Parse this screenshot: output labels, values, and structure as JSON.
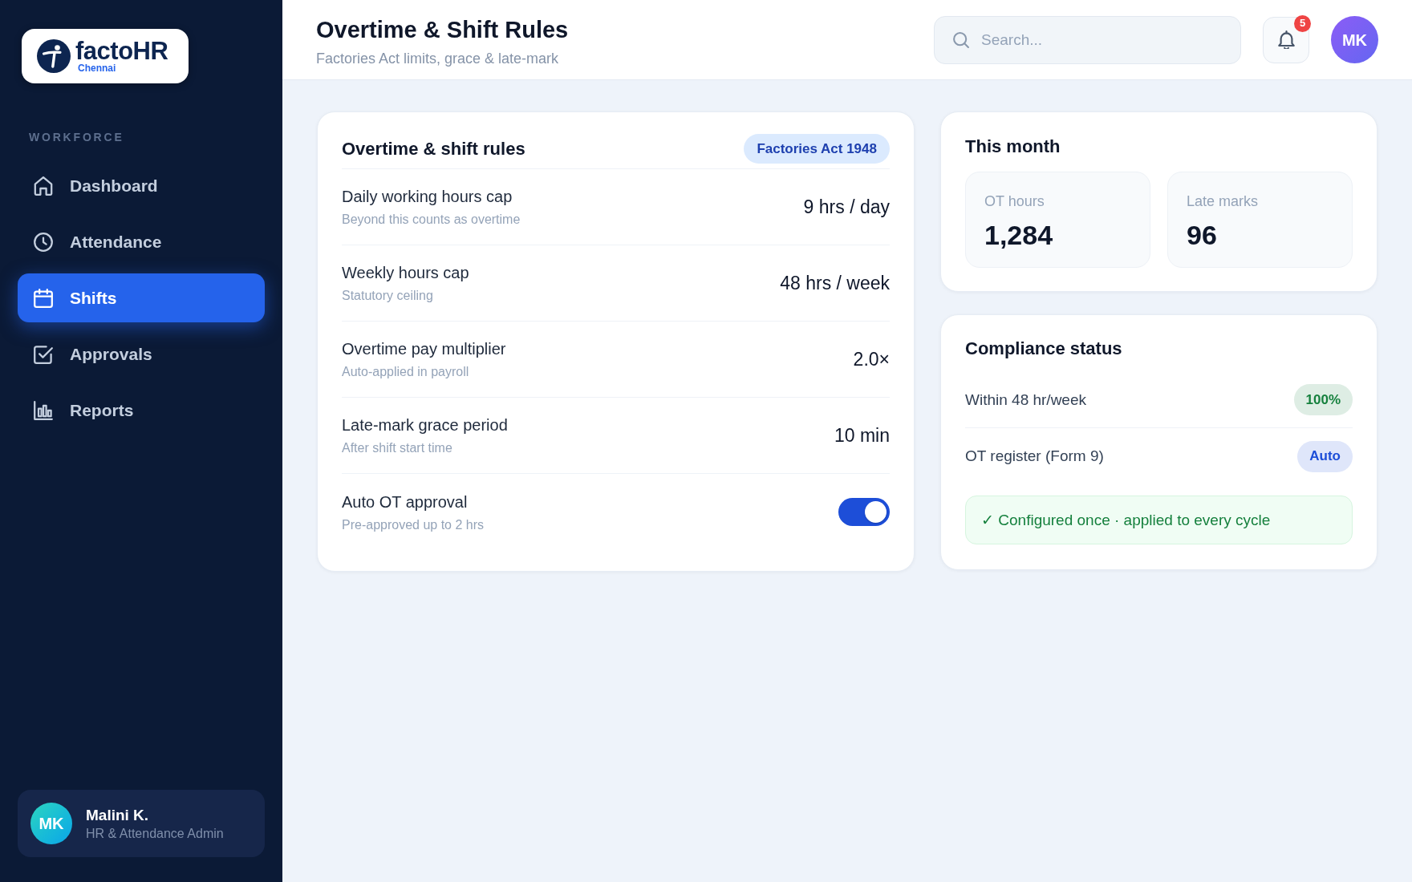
{
  "sidebar": {
    "logo": {
      "wordmark": "factoHR",
      "location": "Chennai"
    },
    "section_label": "WORKFORCE",
    "items": [
      {
        "label": "Dashboard",
        "selected": false
      },
      {
        "label": "Attendance",
        "selected": false
      },
      {
        "label": "Shifts",
        "selected": true
      },
      {
        "label": "Approvals",
        "selected": false
      },
      {
        "label": "Reports",
        "selected": false
      }
    ],
    "user": {
      "initials": "MK",
      "name": "Malini K.",
      "role": "HR & Attendance Admin"
    }
  },
  "header": {
    "title": "Overtime & Shift Rules",
    "subtitle": "Factories Act limits, grace & late-mark",
    "search": {
      "placeholder": "Search..."
    },
    "notifications": {
      "count": "5"
    },
    "avatar": {
      "initials": "MK"
    }
  },
  "rules_card": {
    "title": "Overtime & shift rules",
    "tag": "Factories Act 1948",
    "rows": [
      {
        "kind": "value",
        "label": "Daily working hours cap",
        "description": "Beyond this counts as overtime",
        "value": "9 hrs / day"
      },
      {
        "kind": "value",
        "label": "Weekly hours cap",
        "description": "Statutory ceiling",
        "value": "48 hrs / week"
      },
      {
        "kind": "value",
        "label": "Overtime pay multiplier",
        "description": "Auto-applied in payroll",
        "value": "2.0×"
      },
      {
        "kind": "value",
        "label": "Late-mark grace period",
        "description": "After shift start time",
        "value": "10 min"
      },
      {
        "kind": "toggle",
        "label": "Auto OT approval",
        "description": "Pre-approved up to 2 hrs",
        "on": true
      }
    ]
  },
  "month_card": {
    "title": "This month",
    "stats": [
      {
        "label": "OT hours",
        "value": "1,284"
      },
      {
        "label": "Late marks",
        "value": "96"
      }
    ]
  },
  "compliance_card": {
    "title": "Compliance status",
    "items": [
      {
        "label": "Within 48 hr/week",
        "status": "100%",
        "color": "#15803d"
      },
      {
        "label": "OT register (Form 9)",
        "status": "Auto",
        "color": "#1d4ed8"
      }
    ],
    "note": "✓ Configured once · applied to every cycle"
  }
}
